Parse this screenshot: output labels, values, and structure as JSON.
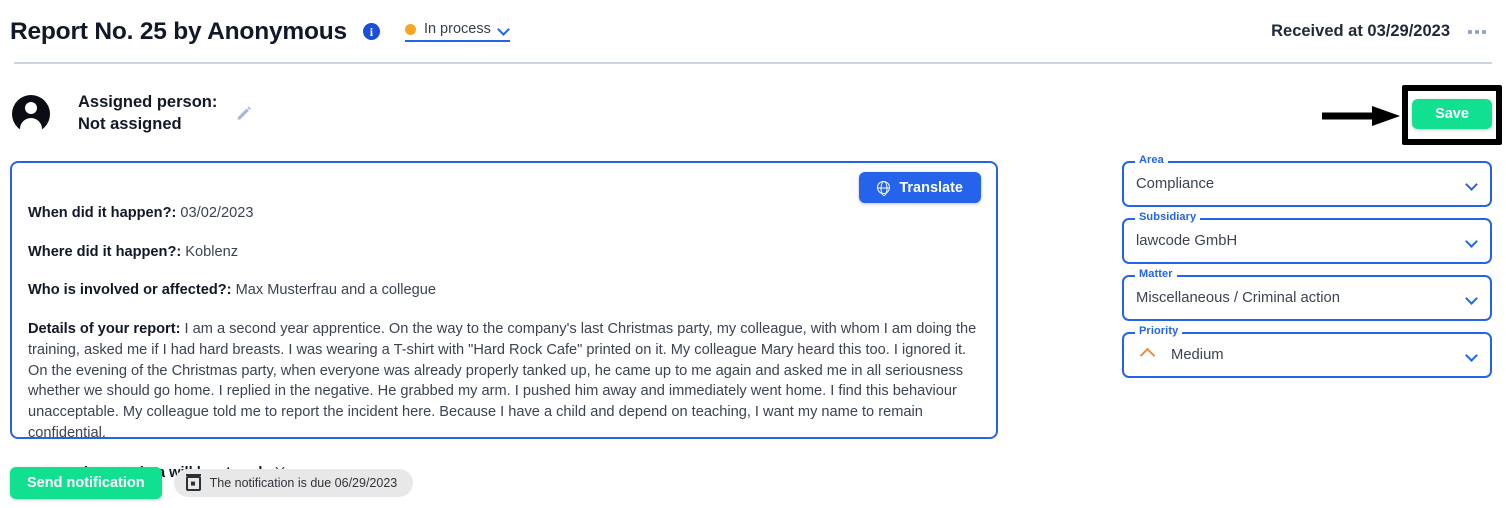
{
  "header": {
    "title": "Report No. 25 by Anonymous",
    "info_icon": "info-icon",
    "status": {
      "label": "In process",
      "dot_color": "#f5a623",
      "chevron_icon": "chevron-down-icon"
    },
    "received": "Received at 03/29/2023",
    "more_menu_icon": "more-horizontal-icon"
  },
  "assignee": {
    "avatar_icon": "user-avatar-icon",
    "label": "Assigned person:",
    "value": "Not assigned",
    "edit_icon": "pencil-icon"
  },
  "annotation": {
    "arrow_icon": "arrow-right-icon",
    "highlight_color": "#000000"
  },
  "actions": {
    "save_label": "Save",
    "save_color": "#10e08f",
    "translate_label": "Translate",
    "translate_icon": "globe-icon",
    "translate_color": "#2563eb",
    "send_notification_label": "Send notification",
    "due_chip_label": "The notification is due 06/29/2023",
    "due_chip_icon": "calendar-icon"
  },
  "report": {
    "border_color": "#2563eb",
    "entries": [
      {
        "question": "When did it happen?:",
        "answer": " 03/02/2023"
      },
      {
        "question": "Where did it happen?:",
        "answer": " Koblenz"
      },
      {
        "question": "Who is involved or affected?:",
        "answer": " Max Musterfrau and a collegue"
      },
      {
        "question": "Details of your report:",
        "answer": " I am a second year apprentice. On the way to the company's last Christmas party, my colleague, with whom I am doing the training, asked me if I had hard breasts. I was wearing a T-shirt with \"Hard Rock Cafe\" printed on it. My colleague Mary heard this too. I ignored it. On the evening of the Christmas party, when everyone was already properly tanked up, he came up to me again and asked me in all seriousness whether we should go home. I replied in the negative. He grabbed my arm. I pushed him away and immediately went home. I find this behaviour unacceptable. My colleague told me to report the incident here. Because I have a child and depend on teaching, I want my name to remain confidential."
      },
      {
        "question": "I agree that my data will be stored.:",
        "answer": " Yes"
      }
    ]
  },
  "fields": [
    {
      "label": "Area",
      "value": "Compliance",
      "chevron_icon": "chevron-down-icon",
      "priority_icon": null
    },
    {
      "label": "Subsidiary",
      "value": "lawcode GmbH",
      "chevron_icon": "chevron-down-icon",
      "priority_icon": null
    },
    {
      "label": "Matter",
      "value": "Miscellaneous / Criminal action",
      "chevron_icon": "chevron-down-icon",
      "priority_icon": null
    },
    {
      "label": "Priority",
      "value": "Medium",
      "chevron_icon": "chevron-down-icon",
      "priority_icon": "priority-medium-icon"
    }
  ]
}
